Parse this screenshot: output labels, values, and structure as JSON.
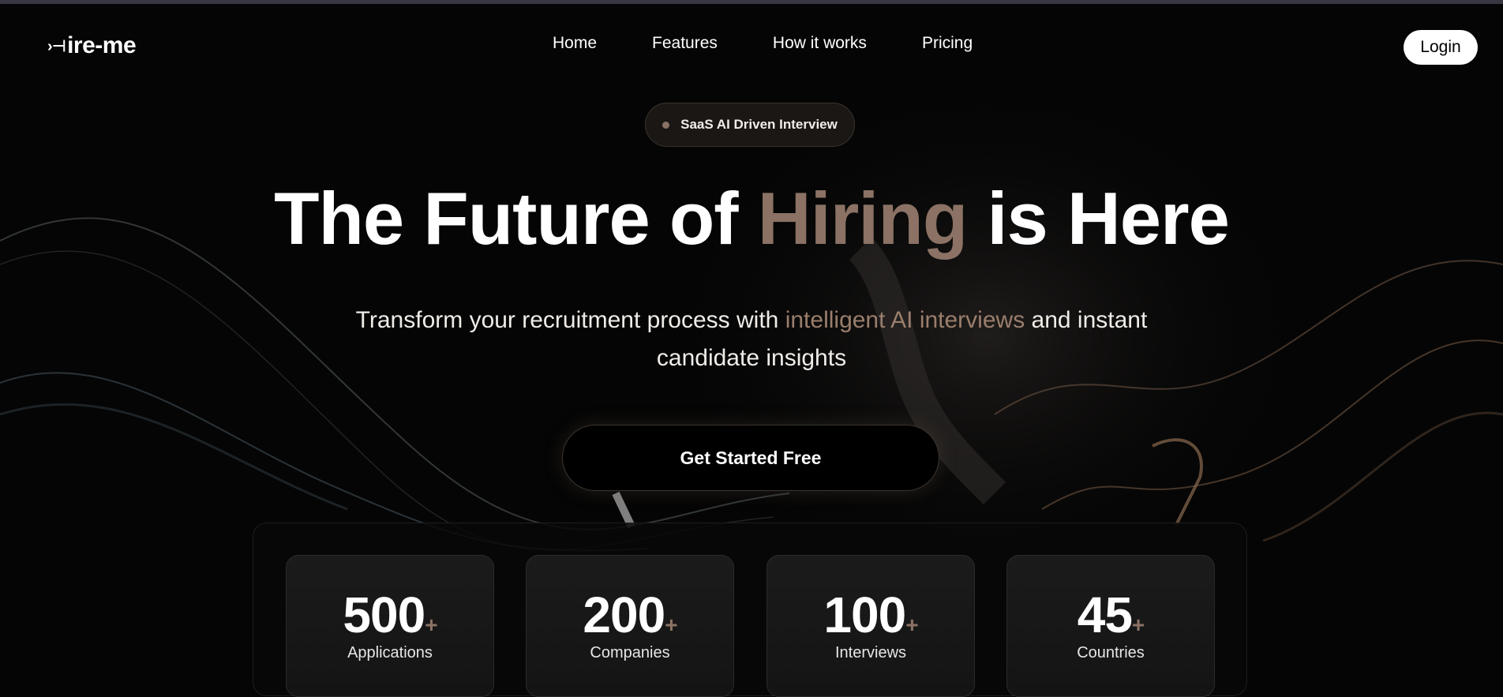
{
  "logo": {
    "mark": "›⊣",
    "text": "ire-me"
  },
  "nav": {
    "items": [
      {
        "label": "Home"
      },
      {
        "label": "Features"
      },
      {
        "label": "How it works"
      },
      {
        "label": "Pricing"
      }
    ]
  },
  "login_label": "Login",
  "badge_text": "SaaS AI Driven Interview",
  "hero": {
    "title_before": "The Future of ",
    "title_accent": "Hiring",
    "title_after": " is Here",
    "subtitle_before": "Transform your recruitment process with ",
    "subtitle_accent": "intelligent AI interviews",
    "subtitle_after": " and instant candidate insights"
  },
  "cta_label": "Get Started Free",
  "stats": [
    {
      "value": "500",
      "suffix": "+",
      "label": "Applications"
    },
    {
      "value": "200",
      "suffix": "+",
      "label": "Companies"
    },
    {
      "value": "100",
      "suffix": "+",
      "label": "Interviews"
    },
    {
      "value": "45",
      "suffix": "+",
      "label": "Countries"
    }
  ],
  "colors": {
    "accent": "#8b7264",
    "background": "#050505",
    "button_light": "#ffffff"
  }
}
